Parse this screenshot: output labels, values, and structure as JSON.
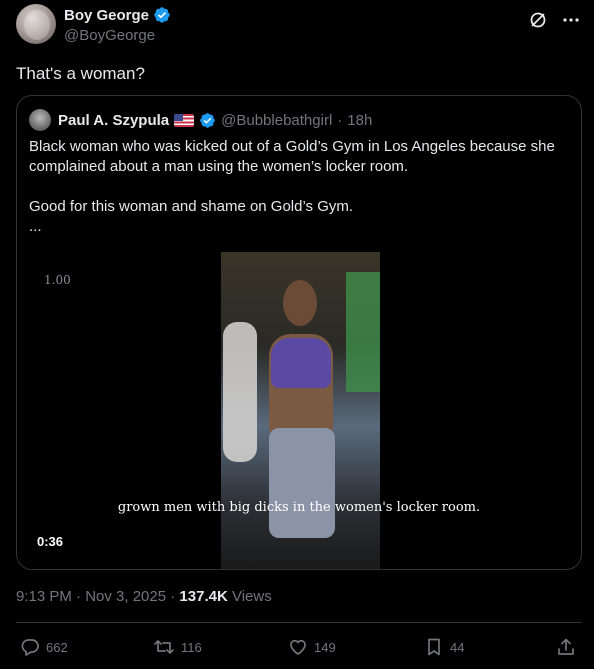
{
  "author": {
    "display_name": "Boy George",
    "handle": "@BoyGeorge"
  },
  "header_icons": [
    "grok-icon",
    "more-icon"
  ],
  "tweet": {
    "text": "That's a woman?"
  },
  "quote": {
    "display_name": "Paul A. Szypula",
    "handle": "@Bubblebathgirl",
    "separator": "·",
    "time": "18h",
    "paragraph_1": "Black woman who was kicked out of a Gold’s Gym in Los Angeles because she complained about a man using the women’s locker room.",
    "paragraph_2": "Good for this woman and shame on Gold’s Gym.",
    "ellipsis": "...",
    "media": {
      "y_tick": "1.00",
      "caption": "grown men with big dicks in the women's locker room.",
      "duration": "0:36"
    }
  },
  "meta": {
    "time": "9:13 PM · Nov 3, 2025 · ",
    "views_count": "137.4K",
    "views_label": " Views"
  },
  "actions": {
    "replies": "662",
    "reposts": "116",
    "likes": "149",
    "bookmarks": "44"
  },
  "colors": {
    "background": "#000000",
    "text": "#e7e9ea",
    "secondary": "#71767b",
    "border": "#2f3336",
    "verified": "#1d9bf0"
  }
}
